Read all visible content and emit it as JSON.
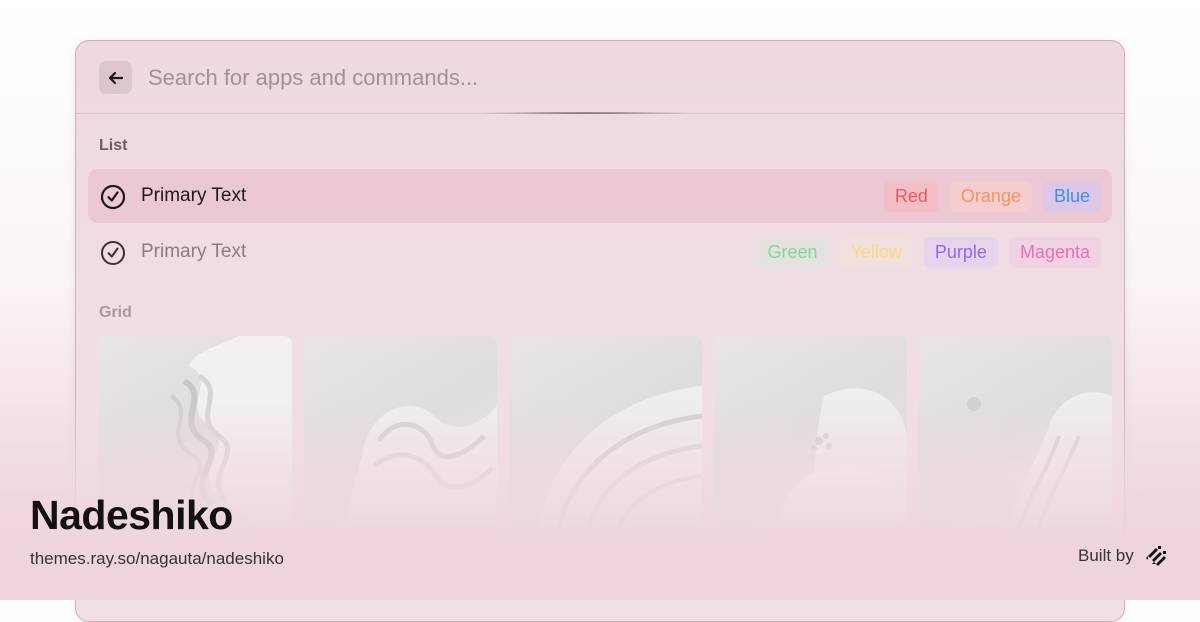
{
  "search": {
    "placeholder": "Search for apps and commands..."
  },
  "icons": {
    "back": "arrow-left-icon",
    "row": "check-circle-icon",
    "logo": "raycast-logo-icon"
  },
  "sections": {
    "list_title": "List",
    "grid_title": "Grid"
  },
  "list": {
    "rows": [
      {
        "text": "Primary Text",
        "selected": true,
        "tags": [
          {
            "label": "Red",
            "color": "#f0575f",
            "bg": "#f3bec8"
          },
          {
            "label": "Orange",
            "color": "#f7935b",
            "bg": "#f4cdd0"
          },
          {
            "label": "Blue",
            "color": "#3d8df2",
            "bg": "#dcc8e6"
          }
        ]
      },
      {
        "text": "Primary Text",
        "selected": false,
        "tags": [
          {
            "label": "Green",
            "color": "#7fd9a5",
            "bg": "#e4e1df"
          },
          {
            "label": "Yellow",
            "color": "#f8d982",
            "bg": "#f1e1de"
          },
          {
            "label": "Purple",
            "color": "#8d69ee",
            "bg": "#e5d4ec"
          },
          {
            "label": "Magenta",
            "color": "#ec6fba",
            "bg": "#f1d2e2"
          }
        ]
      }
    ]
  },
  "grid": {
    "tiles": [
      "wavy-sculpture-1",
      "wavy-sculpture-2",
      "wavy-sculpture-3",
      "wavy-sculpture-4",
      "wavy-sculpture-5"
    ]
  },
  "footer": {
    "title": "Nadeshiko",
    "url": "themes.ray.so/nagauta/nadeshiko",
    "built_by": "Built by"
  },
  "colors": {
    "window_bg": "#f0dbe2",
    "selected_row": "#ecc8d4",
    "page_bottom": "#eed4de"
  }
}
